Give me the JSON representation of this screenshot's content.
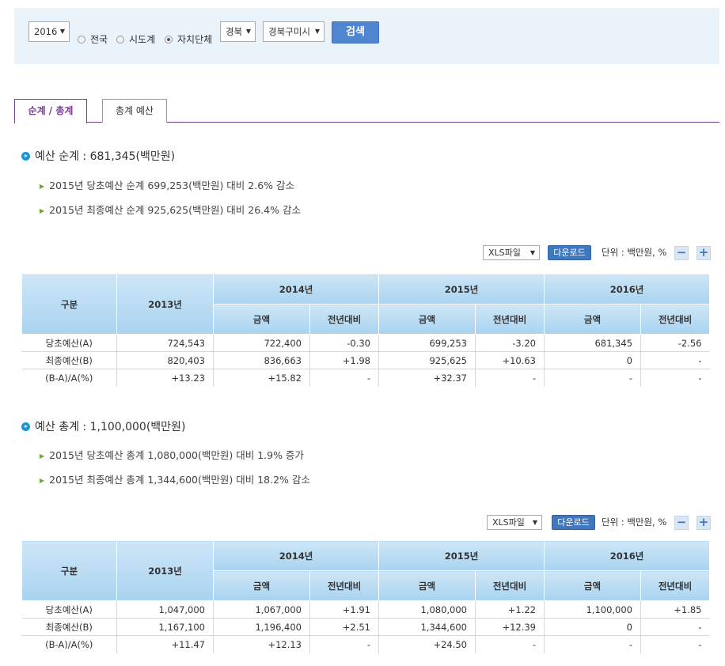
{
  "search": {
    "year": "2016",
    "region_options": [
      "전국",
      "시도계",
      "자치단체"
    ],
    "selected_region": "자치단체",
    "province": "경북",
    "city": "경북구미시",
    "search_label": "검색"
  },
  "tabs": [
    "순계 / 총계",
    "총계 예산"
  ],
  "columns": {
    "category": "구분",
    "y2013": "2013년",
    "y2014": "2014년",
    "y2015": "2015년",
    "y2016": "2016년",
    "amount": "금액",
    "yoy": "전년대비"
  },
  "toolbar": {
    "file_type": "XLS파일",
    "download_label": "다운로드",
    "unit_label": "단위 : 백만원, %",
    "minus": "−",
    "plus": "+"
  },
  "sections": [
    {
      "title": "예산 순계 : 681,345(백만원)",
      "notes": [
        "2015년 당초예산 순계 699,253(백만원) 대비 2.6% 감소",
        "2015년 최종예산 순계 925,625(백만원) 대비 26.4% 감소"
      ],
      "rows": [
        [
          "당초예산(A)",
          "724,543",
          "722,400",
          "-0.30",
          "699,253",
          "-3.20",
          "681,345",
          "-2.56"
        ],
        [
          "최종예산(B)",
          "820,403",
          "836,663",
          "+1.98",
          "925,625",
          "+10.63",
          "0",
          "-"
        ],
        [
          "(B-A)/A(%)",
          "+13.23",
          "+15.82",
          "-",
          "+32.37",
          "-",
          "-",
          "-"
        ]
      ]
    },
    {
      "title": "예산 총계 : 1,100,000(백만원)",
      "notes": [
        "2015년 당초예산 총계 1,080,000(백만원) 대비 1.9% 증가",
        "2015년 최종예산 총계 1,344,600(백만원) 대비 18.2% 감소"
      ],
      "rows": [
        [
          "당초예산(A)",
          "1,047,000",
          "1,067,000",
          "+1.91",
          "1,080,000",
          "+1.22",
          "1,100,000",
          "+1.85"
        ],
        [
          "최종예산(B)",
          "1,167,100",
          "1,196,400",
          "+2.51",
          "1,344,600",
          "+12.39",
          "0",
          "-"
        ],
        [
          "(B-A)/A(%)",
          "+11.47",
          "+12.13",
          "-",
          "+24.50",
          "-",
          "-",
          "-"
        ]
      ]
    }
  ]
}
